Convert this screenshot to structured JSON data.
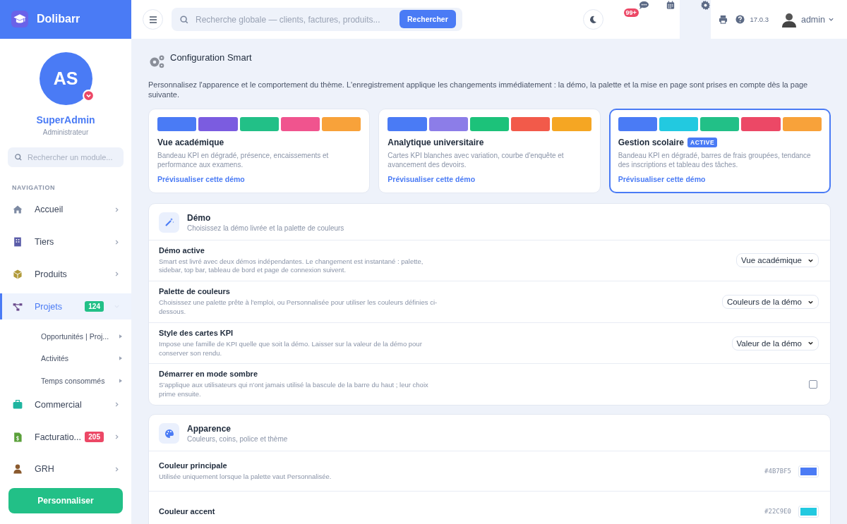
{
  "brand": {
    "name": "Dolibarr"
  },
  "profile": {
    "initials": "AS",
    "name": "SuperAdmin",
    "role": "Administrateur"
  },
  "sidebar": {
    "search": {
      "placeholder": "Rechercher un module..."
    },
    "section": "NAVIGATION",
    "items": [
      {
        "label": "Accueil",
        "selected": false,
        "expanded": false
      },
      {
        "label": "Tiers",
        "selected": false,
        "expanded": false
      },
      {
        "label": "Produits",
        "selected": false,
        "expanded": false
      },
      {
        "label": "Projets",
        "selected": true,
        "expanded": true,
        "badge": "124",
        "color": "#22c087",
        "children": [
          {
            "label": "Opportunités | Proj..."
          },
          {
            "label": "Activités"
          },
          {
            "label": "Temps consommés"
          }
        ]
      },
      {
        "label": "Commercial",
        "selected": false,
        "expanded": false
      },
      {
        "label": "Facturatio...",
        "selected": false,
        "expanded": false,
        "badge": "205",
        "color": "#ec4866"
      },
      {
        "label": "GRH",
        "selected": false,
        "expanded": false
      }
    ],
    "button": "Personnaliser"
  },
  "topbar": {
    "search": {
      "placeholder": "Recherche globale — clients, factures, produits..."
    },
    "search_button": "Rechercher",
    "notifications": "99+",
    "version": "17.0.3",
    "user": "admin"
  },
  "page": {
    "title": "Configuration Smart",
    "intro": "Personnalisez l'apparence et le comportement du thème. L'enregistrement applique les changements immédiatement : la démo, la palette et la mise en page sont prises en compte dès la page suivante.",
    "demos": [
      {
        "title": "Vue académique",
        "description": "Bandeau KPI en dégradé, présence, encaissements et performance aux examens.",
        "link": "Prévisualiser cette démo",
        "selected": false,
        "swatches": [
          {
            "color": "#4a7bf5"
          },
          {
            "color": "#7b5ce0"
          },
          {
            "color": "#22c087"
          },
          {
            "color": "#f0548e"
          },
          {
            "color": "#f8a23a"
          }
        ]
      },
      {
        "title": "Analytique universitaire",
        "description": "Cartes KPI blanches avec variation, courbe d'enquête et avancement des devoirs.",
        "link": "Prévisualiser cette démo",
        "selected": false,
        "swatches": [
          {
            "color": "#4a7bf5"
          },
          {
            "color": "#8c7de8"
          },
          {
            "color": "#1cc27a"
          },
          {
            "color": "#f25a4a"
          },
          {
            "color": "#f5a623"
          }
        ]
      },
      {
        "title": "Gestion scolaire",
        "badge": "ACTIVE",
        "description": "Bandeau KPI en dégradé, barres de frais groupées, tendance des inscriptions et tableau des tâches.",
        "link": "Prévisualiser cette démo",
        "selected": true,
        "swatches": [
          {
            "color": "#4a7bf5"
          },
          {
            "color": "#22c9e0"
          },
          {
            "color": "#22c087"
          },
          {
            "color": "#ec4866"
          },
          {
            "color": "#f8a23a"
          }
        ]
      }
    ],
    "sections": [
      {
        "title": "Démo",
        "subtitle": "Choisissez la démo livrée et la palette de couleurs",
        "rows": [
          {
            "kind": "select",
            "label": "Démo active",
            "description": "Smart est livré avec deux démos indépendantes. Le changement est instantané : palette, sidebar, top bar, tableau de bord et page de connexion suivent.",
            "value": "Vue académique"
          },
          {
            "kind": "select",
            "label": "Palette de couleurs",
            "description": "Choisissez une palette prête à l'emploi, ou Personnalisée pour utiliser les couleurs définies ci-dessous.",
            "value": "Couleurs de la démo"
          },
          {
            "kind": "select",
            "label": "Style des cartes KPI",
            "description": "Impose une famille de KPI quelle que soit la démo. Laisser sur la valeur de la démo pour conserver son rendu.",
            "value": "Valeur de la démo"
          },
          {
            "kind": "checkbox",
            "label": "Démarrer en mode sombre",
            "description": "S'applique aux utilisateurs qui n'ont jamais utilisé la bascule de la barre du haut ; leur choix prime ensuite.",
            "checked": false
          }
        ]
      },
      {
        "title": "Apparence",
        "subtitle": "Couleurs, coins, police et thème",
        "rows": [
          {
            "kind": "color",
            "label": "Couleur principale",
            "description": "Utilisée uniquement lorsque la palette vaut Personnalisée.",
            "value": "#4B7BF5",
            "color": "#4b7bf5"
          },
          {
            "kind": "color",
            "label": "Couleur accent",
            "value": "#22C9E0",
            "color": "#22c9e0"
          }
        ]
      }
    ]
  }
}
